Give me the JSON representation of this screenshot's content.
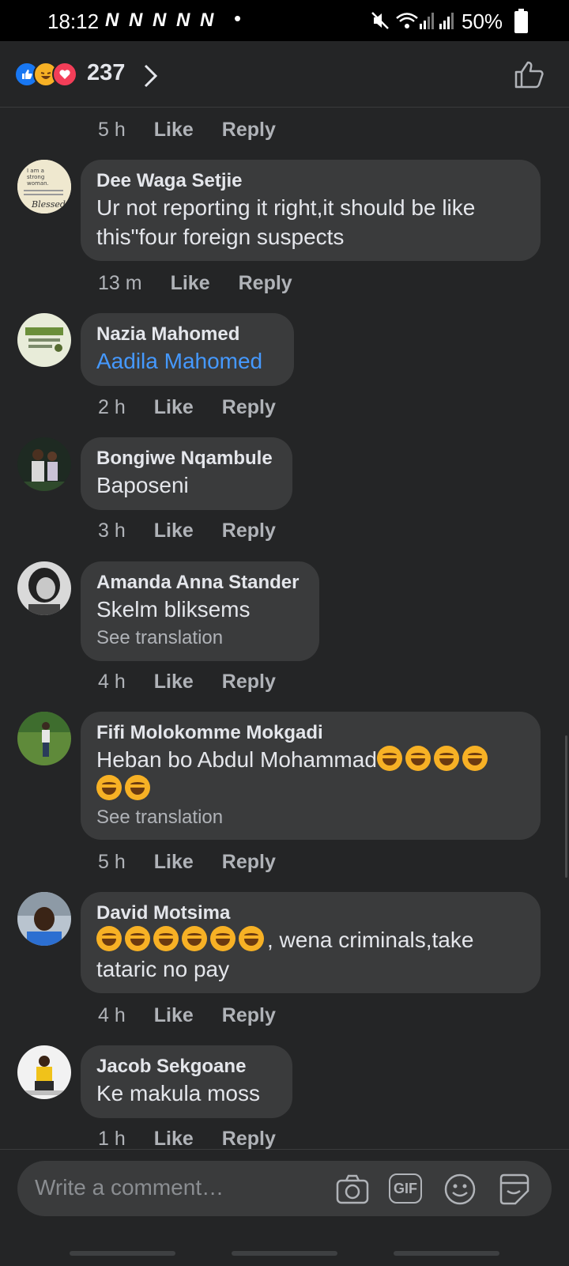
{
  "status_bar": {
    "time": "18:12",
    "notification_icons": "N N N N N",
    "battery": "50%"
  },
  "header": {
    "reaction_count": "237",
    "reactions": [
      "like-icon",
      "haha-icon",
      "love-icon"
    ]
  },
  "top_meta": {
    "age": "5 h",
    "like": "Like",
    "reply": "Reply"
  },
  "comments": [
    {
      "author": "Dee Waga Setjie",
      "lines": [
        "Ur not reporting it right,it should be like",
        "this\"four foreign suspects"
      ],
      "age": "13 m",
      "like": "Like",
      "reply": "Reply"
    },
    {
      "author": "Nazia Mahomed",
      "lines": [
        "Aadila Mahomed"
      ],
      "age": "2 h",
      "like": "Like",
      "reply": "Reply"
    },
    {
      "author": "Bongiwe Nqambule",
      "lines": [
        "Baposeni"
      ],
      "age": "3 h",
      "like": "Like",
      "reply": "Reply"
    },
    {
      "author": "Amanda Anna Stander",
      "lines": [
        "Skelm bliksems"
      ],
      "see_translation": "See translation",
      "age": "4 h",
      "like": "Like",
      "reply": "Reply"
    },
    {
      "author": "Fifi Molokomme Mokgadi",
      "lines": [
        "Heban  bo Abdul Mohammad"
      ],
      "see_translation": "See translation",
      "age": "5 h",
      "like": "Like",
      "reply": "Reply"
    },
    {
      "author": "David Motsima",
      "lines": [
        ", wena criminals,take",
        "tataric no pay"
      ],
      "age": "4 h",
      "like": "Like",
      "reply": "Reply"
    },
    {
      "author": "Jacob Sekgoane",
      "lines": [
        "Ke makula moss"
      ],
      "age": "1 h",
      "like": "Like",
      "reply": "Reply"
    }
  ],
  "composer": {
    "placeholder": "Write a comment…",
    "gif_label": "GIF"
  },
  "colors": {
    "background": "#242526",
    "bubble": "#3a3b3c",
    "mention": "#4599ff",
    "like_blue": "#1877f2"
  }
}
